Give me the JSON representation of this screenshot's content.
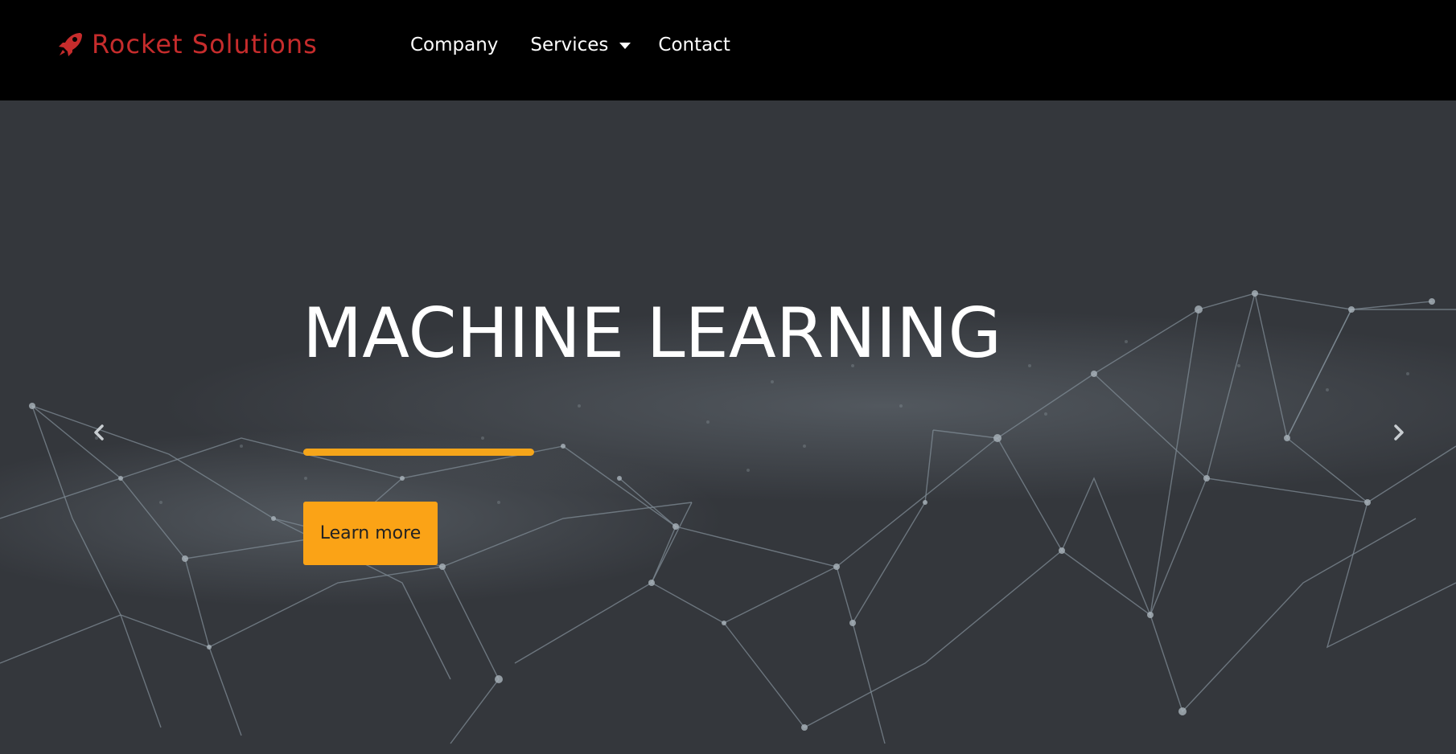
{
  "brand": {
    "name": "Rocket Solutions",
    "color": "#c62c2c",
    "icon": "rocket-icon"
  },
  "nav": {
    "items": [
      {
        "label": "Company"
      },
      {
        "label": "Services",
        "has_dropdown": true
      },
      {
        "label": "Contact"
      }
    ]
  },
  "hero": {
    "title": "MACHINE LEARNING",
    "button_label": "Learn more",
    "accent_color": "#fba316",
    "background_color": "#34373c",
    "prev_icon": "chevron-left-icon",
    "next_icon": "chevron-right-icon"
  }
}
